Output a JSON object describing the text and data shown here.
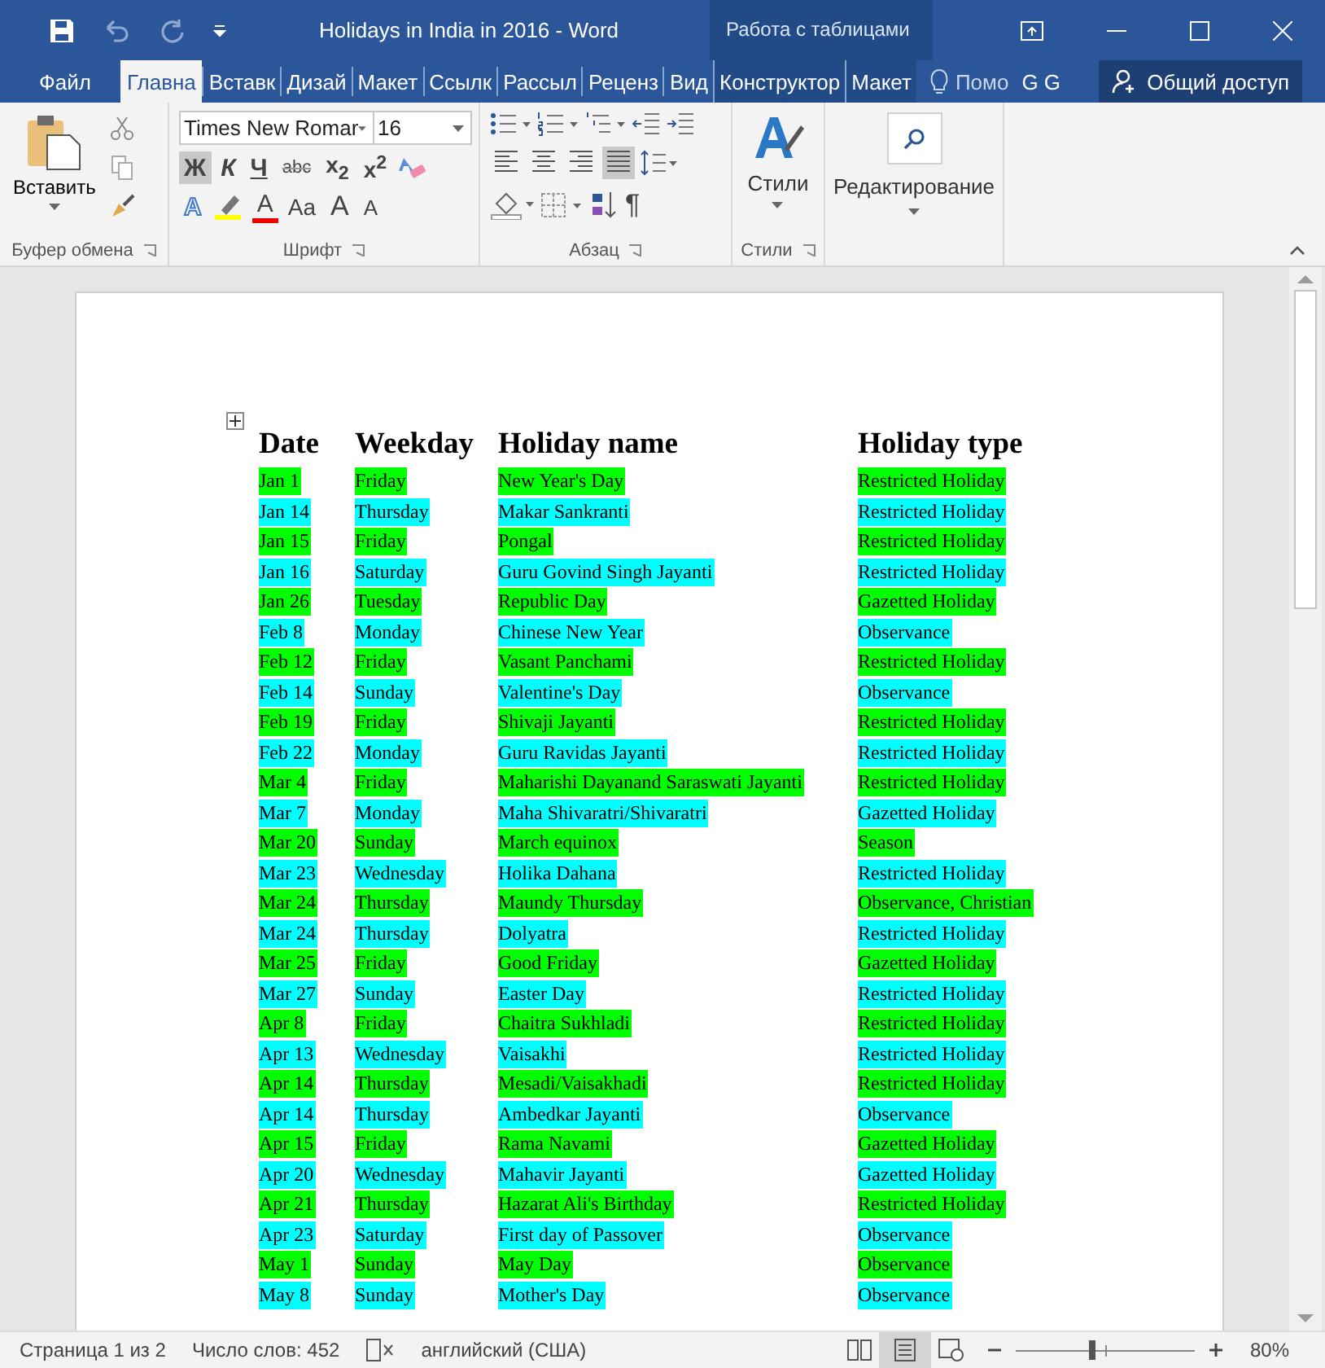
{
  "window": {
    "title": "Holidays in India in 2016 - Word",
    "context_title": "Работа с таблицами"
  },
  "tabs": [
    {
      "label": "Файл",
      "selected": false,
      "contextual": false
    },
    {
      "label": "Главна",
      "selected": true,
      "contextual": false
    },
    {
      "label": "Вставк",
      "selected": false,
      "contextual": false
    },
    {
      "label": "Дизай",
      "selected": false,
      "contextual": false
    },
    {
      "label": "Макет",
      "selected": false,
      "contextual": false
    },
    {
      "label": "Ссылк",
      "selected": false,
      "contextual": false
    },
    {
      "label": "Рассыл",
      "selected": false,
      "contextual": false
    },
    {
      "label": "Реценз",
      "selected": false,
      "contextual": false
    },
    {
      "label": "Вид",
      "selected": false,
      "contextual": false
    },
    {
      "label": "Конструктор",
      "selected": false,
      "contextual": true
    },
    {
      "label": "Макет",
      "selected": false,
      "contextual": true
    }
  ],
  "tell_me": "Помо",
  "user": "G G",
  "share": "Общий доступ",
  "ribbon": {
    "clipboard": {
      "paste": "Вставить",
      "group": "Буфер обмена"
    },
    "font": {
      "name": "Times New Romar",
      "size": "16",
      "group": "Шрифт",
      "row1": [
        {
          "kind": "bold",
          "label": "Ж",
          "selected": true
        },
        {
          "kind": "italic",
          "label": "К",
          "selected": false
        },
        {
          "kind": "underline",
          "label": "Ч",
          "selected": false
        },
        {
          "kind": "strike",
          "label": "abc",
          "selected": false
        },
        {
          "kind": "sub",
          "label": "x$_{2}$",
          "selected": false
        },
        {
          "kind": "sup",
          "label": "x$^{2}$",
          "selected": false
        }
      ],
      "row2": [
        {
          "kind": "effects",
          "label": "A"
        },
        {
          "kind": "color",
          "label": "A"
        },
        {
          "kind": "case",
          "label": "Aa"
        },
        {
          "kind": "grow",
          "label": "A"
        },
        {
          "kind": "shrink",
          "label": "A"
        }
      ]
    },
    "paragraph": {
      "group": "Абзац",
      "align": [
        {
          "selected": false
        },
        {
          "selected": false
        },
        {
          "selected": false
        },
        {
          "selected": true
        }
      ],
      "marks": "¶"
    },
    "styles": {
      "label": "Стили",
      "group": "Стили"
    },
    "editing": {
      "label": "Редактирование"
    }
  },
  "table": {
    "columns": [
      "Date",
      "Weekday",
      "Holiday name",
      "Holiday type"
    ],
    "rows": [
      {
        "cells": [
          "Jan 1",
          "Friday",
          "New Year's Day",
          "Restricted Holiday"
        ],
        "color": "#00ff00"
      },
      {
        "cells": [
          "Jan 14",
          "Thursday",
          "Makar Sankranti",
          "Restricted Holiday"
        ],
        "color": "#00ffff"
      },
      {
        "cells": [
          "Jan 15",
          "Friday",
          "Pongal",
          "Restricted Holiday"
        ],
        "color": "#00ff00"
      },
      {
        "cells": [
          "Jan 16",
          "Saturday",
          "Guru Govind Singh Jayanti",
          "Restricted Holiday"
        ],
        "color": "#00ffff"
      },
      {
        "cells": [
          "Jan 26",
          "Tuesday",
          "Republic Day",
          "Gazetted Holiday"
        ],
        "color": "#00ff00"
      },
      {
        "cells": [
          "Feb 8",
          "Monday",
          "Chinese New Year",
          "Observance"
        ],
        "color": "#00ffff"
      },
      {
        "cells": [
          "Feb 12",
          "Friday",
          "Vasant Panchami",
          "Restricted Holiday"
        ],
        "color": "#00ff00"
      },
      {
        "cells": [
          "Feb 14",
          "Sunday",
          "Valentine's Day",
          "Observance"
        ],
        "color": "#00ffff"
      },
      {
        "cells": [
          "Feb 19",
          "Friday",
          "Shivaji Jayanti",
          "Restricted Holiday"
        ],
        "color": "#00ff00"
      },
      {
        "cells": [
          "Feb 22",
          "Monday",
          "Guru Ravidas Jayanti",
          "Restricted Holiday"
        ],
        "color": "#00ffff"
      },
      {
        "cells": [
          "Mar 4",
          "Friday",
          "Maharishi Dayanand Saraswati Jayanti",
          "Restricted Holiday"
        ],
        "color": "#00ff00"
      },
      {
        "cells": [
          "Mar 7",
          "Monday",
          "Maha Shivaratri/Shivaratri",
          "Gazetted Holiday"
        ],
        "color": "#00ffff"
      },
      {
        "cells": [
          "Mar 20",
          "Sunday",
          "March equinox",
          "Season"
        ],
        "color": "#00ff00"
      },
      {
        "cells": [
          "Mar 23",
          "Wednesday",
          "Holika Dahana",
          "Restricted Holiday"
        ],
        "color": "#00ffff"
      },
      {
        "cells": [
          "Mar 24",
          "Thursday",
          "Maundy Thursday",
          "Observance, Christian"
        ],
        "color": "#00ff00"
      },
      {
        "cells": [
          "Mar 24",
          "Thursday",
          "Dolyatra",
          "Restricted Holiday"
        ],
        "color": "#00ffff"
      },
      {
        "cells": [
          "Mar 25",
          "Friday",
          "Good Friday",
          "Gazetted Holiday"
        ],
        "color": "#00ff00"
      },
      {
        "cells": [
          "Mar 27",
          "Sunday",
          "Easter Day",
          "Restricted Holiday"
        ],
        "color": "#00ffff"
      },
      {
        "cells": [
          "Apr 8",
          "Friday",
          "Chaitra Sukhladi",
          "Restricted Holiday"
        ],
        "color": "#00ff00"
      },
      {
        "cells": [
          "Apr 13",
          "Wednesday",
          "Vaisakhi",
          "Restricted Holiday"
        ],
        "color": "#00ffff"
      },
      {
        "cells": [
          "Apr 14",
          "Thursday",
          "Mesadi/Vaisakhadi",
          "Restricted Holiday"
        ],
        "color": "#00ff00"
      },
      {
        "cells": [
          "Apr 14",
          "Thursday",
          "Ambedkar Jayanti",
          "Observance"
        ],
        "color": "#00ffff"
      },
      {
        "cells": [
          "Apr 15",
          "Friday",
          "Rama Navami",
          "Gazetted Holiday"
        ],
        "color": "#00ff00"
      },
      {
        "cells": [
          "Apr 20",
          "Wednesday",
          "Mahavir Jayanti",
          "Gazetted Holiday"
        ],
        "color": "#00ffff"
      },
      {
        "cells": [
          "Apr 21",
          "Thursday",
          "Hazarat Ali's Birthday",
          "Restricted Holiday"
        ],
        "color": "#00ff00"
      },
      {
        "cells": [
          "Apr 23",
          "Saturday",
          "First day of Passover",
          "Observance"
        ],
        "color": "#00ffff"
      },
      {
        "cells": [
          "May 1",
          "Sunday",
          "May Day",
          "Observance"
        ],
        "color": "#00ff00"
      },
      {
        "cells": [
          "May 8",
          "Sunday",
          "Mother's Day",
          "Observance"
        ],
        "color": "#00ffff"
      }
    ]
  },
  "status_bar": {
    "page": "Страница 1 из 2",
    "words": "Число слов: 452",
    "language": "английский (США)",
    "views": [
      {
        "selected": false
      },
      {
        "selected": true
      },
      {
        "selected": false
      }
    ],
    "zoom": {
      "level": 0.43,
      "reading": "80%"
    }
  }
}
